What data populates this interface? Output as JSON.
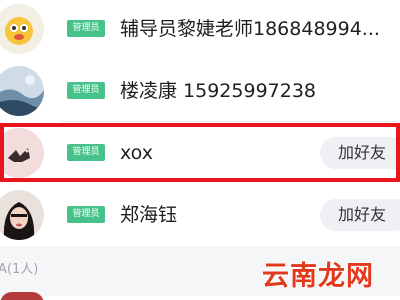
{
  "members": [
    {
      "name": "辅导员黎婕老师186848994...",
      "badge": "管理员",
      "avatar_icon": "emoji-face-avatar",
      "has_add_button": false
    },
    {
      "name": "楼凌康  15925997238",
      "badge": "管理员",
      "avatar_icon": "landscape-avatar",
      "has_add_button": false
    },
    {
      "name": "xox",
      "badge": "管理员",
      "avatar_icon": "bird-avatar",
      "has_add_button": true,
      "highlighted": true
    },
    {
      "name": "郑海钰",
      "badge": "管理员",
      "avatar_icon": "girl-photo-avatar",
      "has_add_button": true
    }
  ],
  "add_friend_label": "加好友",
  "section": {
    "label": "A(1人)"
  },
  "watermark": {
    "text": "云南龙网",
    "color": "#e23a1d"
  },
  "colors": {
    "badge": "#46c28a",
    "highlight": "#e8161c",
    "button_bg": "#eef0f4"
  }
}
